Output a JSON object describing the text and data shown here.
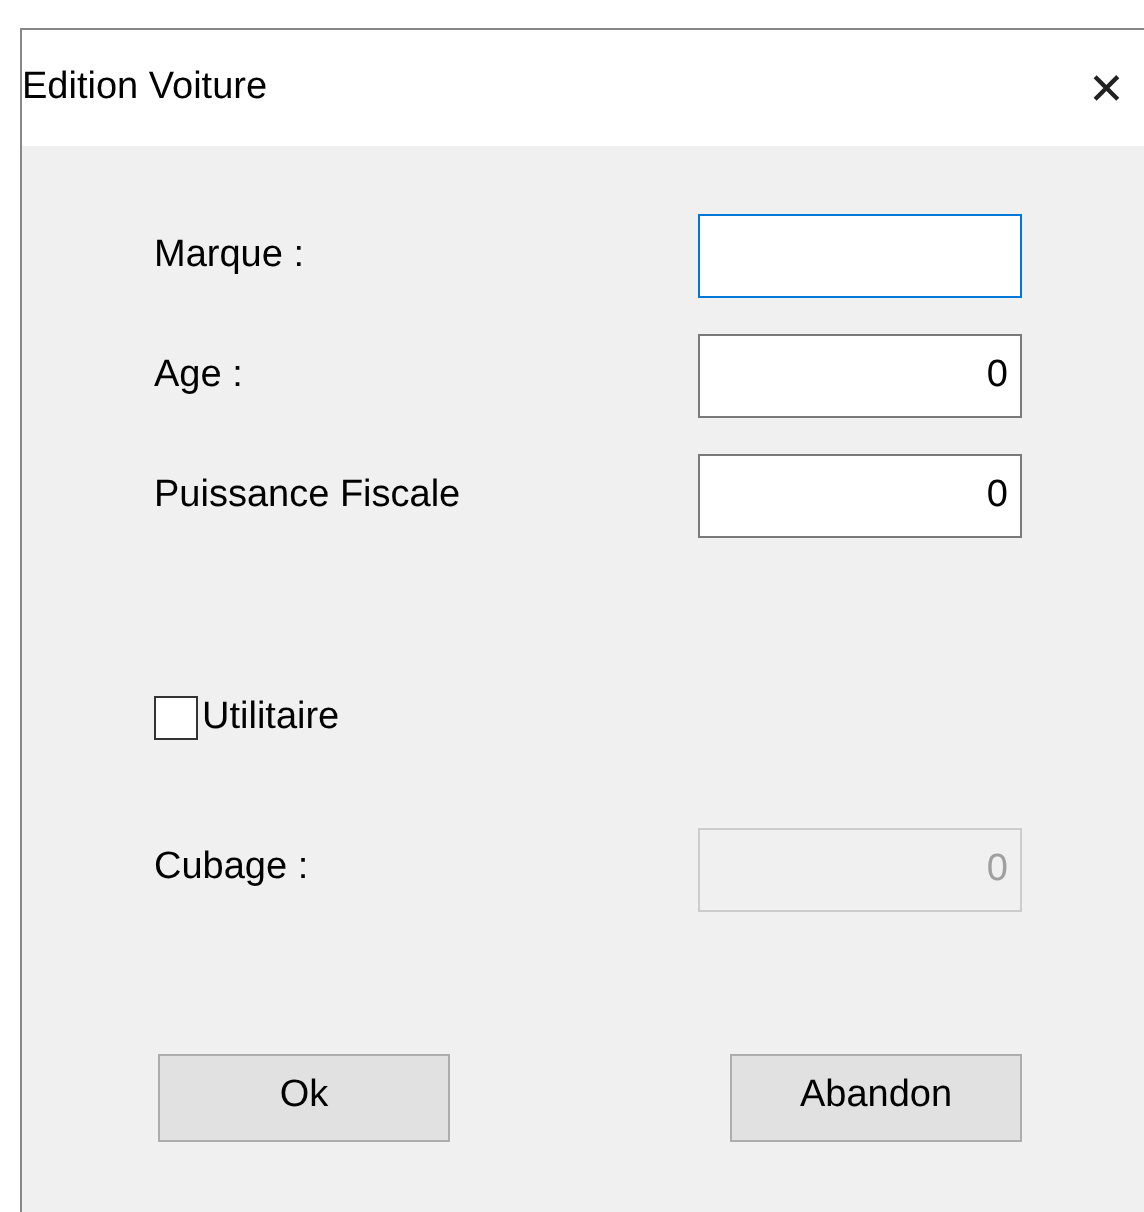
{
  "window": {
    "title": "Edition Voiture",
    "close": "✕"
  },
  "fields": [
    {
      "kind": "text",
      "label": "Marque :",
      "focused": true,
      "disabled": false
    },
    {
      "kind": "text",
      "label": "Age :",
      "value": "0",
      "focused": false,
      "disabled": false
    },
    {
      "kind": "text",
      "label": "Puissance Fiscale",
      "value": "0",
      "focused": false,
      "disabled": false
    },
    {
      "kind": "checkbox",
      "label": "Utilitaire",
      "checked": false
    },
    {
      "kind": "text",
      "label": "Cubage :",
      "value": "0",
      "focused": false,
      "disabled": true
    }
  ],
  "buttons": [
    "Ok",
    "Abandon"
  ]
}
